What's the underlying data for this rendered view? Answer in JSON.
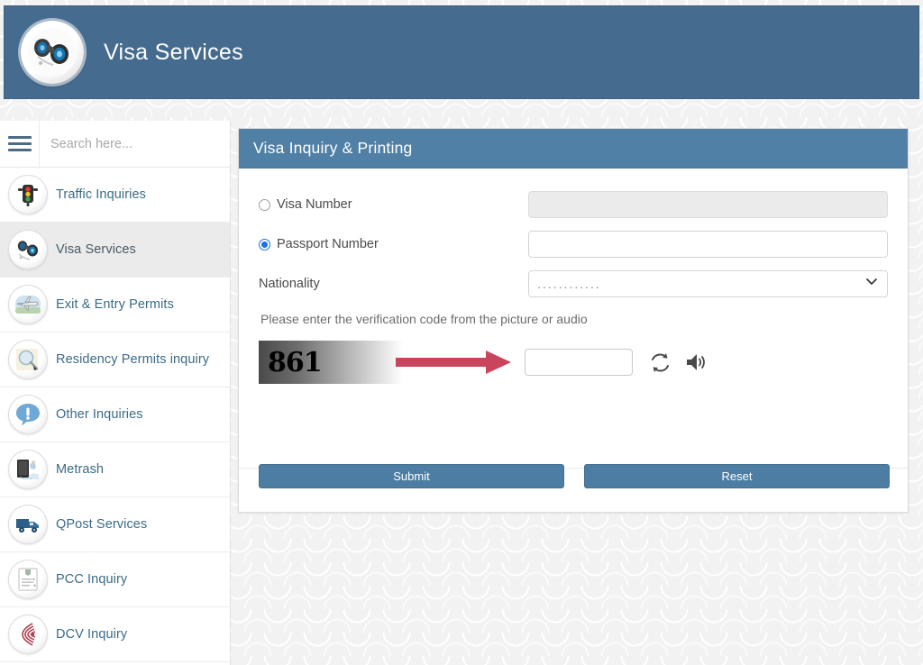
{
  "header": {
    "title": "Visa Services",
    "logo_icon": "binoculars-icon",
    "bar_color": "#456b8e"
  },
  "sidebar": {
    "menu_icon": "hamburger-menu-icon",
    "search": {
      "placeholder": "Search here...",
      "value": ""
    },
    "items": [
      {
        "label": "Traffic Inquiries",
        "icon": "traffic-light-icon",
        "active": false
      },
      {
        "label": "Visa Services",
        "icon": "binoculars-icon",
        "active": true
      },
      {
        "label": "Exit & Entry Permits",
        "icon": "airplane-icon",
        "active": false
      },
      {
        "label": "Residency Permits inquiry",
        "icon": "magnifier-icon",
        "active": false
      },
      {
        "label": "Other Inquiries",
        "icon": "info-bubble-icon",
        "active": false
      },
      {
        "label": "Metrash",
        "icon": "tablet-device-icon",
        "active": false
      },
      {
        "label": "QPost Services",
        "icon": "delivery-truck-icon",
        "active": false
      },
      {
        "label": "PCC Inquiry",
        "icon": "certificate-icon",
        "active": false
      },
      {
        "label": "DCV Inquiry",
        "icon": "fingerprint-icon",
        "active": false
      }
    ]
  },
  "panel": {
    "title": "Visa Inquiry & Printing",
    "header_color": "#5080a5",
    "options": {
      "visa_number": {
        "label": "Visa Number",
        "selected": false,
        "value": "",
        "disabled": true
      },
      "passport_number": {
        "label": "Passport Number",
        "selected": true,
        "value": "",
        "disabled": false
      }
    },
    "nationality": {
      "label": "Nationality",
      "value": "............",
      "dropdown_icon": "chevron-down-icon"
    },
    "captcha": {
      "hint": "Please enter the verification code from the picture or audio",
      "code_text": "861",
      "input_value": "",
      "refresh_icon": "refresh-icon",
      "audio_icon": "speaker-icon",
      "annotation": {
        "shape": "right-arrow",
        "color": "#c8455c"
      }
    },
    "buttons": {
      "submit_label": "Submit",
      "reset_label": "Reset",
      "color": "#4d7da3"
    }
  }
}
